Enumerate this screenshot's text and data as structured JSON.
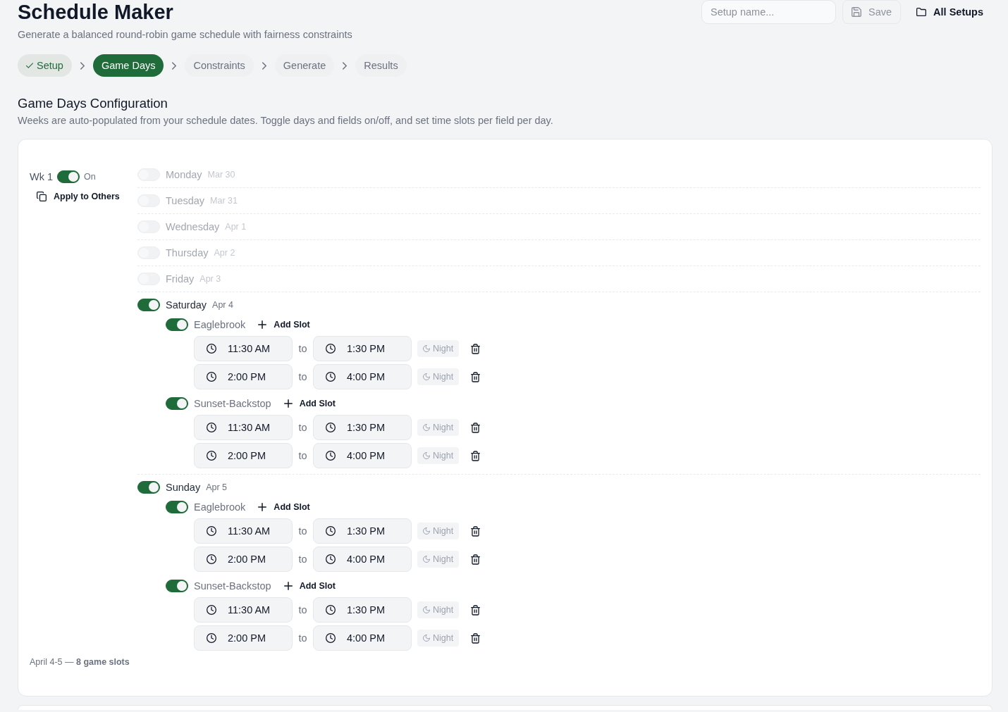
{
  "header": {
    "title": "Schedule Maker",
    "subtitle": "Generate a balanced round-robin game schedule with fairness constraints",
    "setup_name": {
      "placeholder": "Setup name..."
    },
    "actions": [
      {
        "kind": "save",
        "label": "Save",
        "disabled": true
      },
      {
        "kind": "folder",
        "label": "All Setups",
        "disabled": false
      }
    ]
  },
  "steps": [
    {
      "label": "Setup",
      "completed": true,
      "selected": false
    },
    {
      "label": "Game Days",
      "completed": false,
      "selected": true
    },
    {
      "label": "Constraints",
      "completed": false,
      "selected": false
    },
    {
      "label": "Generate",
      "completed": false,
      "selected": false
    },
    {
      "label": "Results",
      "completed": false,
      "selected": false
    }
  ],
  "section": {
    "title": "Game Days Configuration",
    "description": "Weeks are auto-populated from your schedule dates. Toggle days and fields on/off, and set time slots per field per day."
  },
  "weeks": [
    {
      "label": "Wk 1",
      "on": true,
      "state_label": "On",
      "apply_label": "Apply to Others",
      "days": [
        {
          "name": "Monday",
          "date": "Mar 30",
          "on": false
        },
        {
          "name": "Tuesday",
          "date": "Mar 31",
          "on": false
        },
        {
          "name": "Wednesday",
          "date": "Apr 1",
          "on": false
        },
        {
          "name": "Thursday",
          "date": "Apr 2",
          "on": false
        },
        {
          "name": "Friday",
          "date": "Apr 3",
          "on": false
        },
        {
          "name": "Saturday",
          "date": "Apr 4",
          "on": true,
          "fields": [
            {
              "name": "Eaglebrook",
              "on": true,
              "add_label": "Add Slot",
              "slots": [
                {
                  "start": "11:30 AM",
                  "separator": "to",
                  "end": "1:30 PM",
                  "night_label": "Night",
                  "night": false
                },
                {
                  "start": "2:00 PM",
                  "separator": "to",
                  "end": "4:00 PM",
                  "night_label": "Night",
                  "night": false
                }
              ]
            },
            {
              "name": "Sunset-Backstop",
              "on": true,
              "add_label": "Add Slot",
              "slots": [
                {
                  "start": "11:30 AM",
                  "separator": "to",
                  "end": "1:30 PM",
                  "night_label": "Night",
                  "night": false
                },
                {
                  "start": "2:00 PM",
                  "separator": "to",
                  "end": "4:00 PM",
                  "night_label": "Night",
                  "night": false
                }
              ]
            }
          ]
        },
        {
          "name": "Sunday",
          "date": "Apr 5",
          "on": true,
          "fields": [
            {
              "name": "Eaglebrook",
              "on": true,
              "add_label": "Add Slot",
              "slots": [
                {
                  "start": "11:30 AM",
                  "separator": "to",
                  "end": "1:30 PM",
                  "night_label": "Night",
                  "night": false
                },
                {
                  "start": "2:00 PM",
                  "separator": "to",
                  "end": "4:00 PM",
                  "night_label": "Night",
                  "night": false
                }
              ]
            },
            {
              "name": "Sunset-Backstop",
              "on": true,
              "add_label": "Add Slot",
              "slots": [
                {
                  "start": "11:30 AM",
                  "separator": "to",
                  "end": "1:30 PM",
                  "night_label": "Night",
                  "night": false
                },
                {
                  "start": "2:00 PM",
                  "separator": "to",
                  "end": "4:00 PM",
                  "night_label": "Night",
                  "night": false
                }
              ]
            }
          ]
        }
      ],
      "summary": "April 4-5 — **8 game slots**"
    }
  ]
}
